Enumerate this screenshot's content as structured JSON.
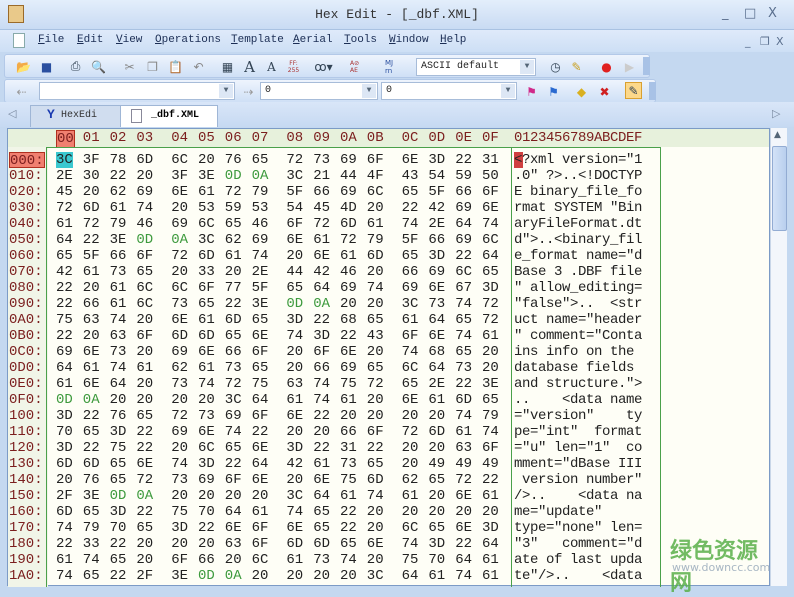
{
  "window": {
    "title": "Hex Edit - [_dbf.XML]",
    "minimize": "_",
    "maximize": "□",
    "close": "X"
  },
  "menu": [
    "File",
    "Edit",
    "View",
    "Operations",
    "Template",
    "Aerial",
    "Tools",
    "Window",
    "Help"
  ],
  "mdi": {
    "minimize": "_",
    "restore": "❐",
    "close": "X"
  },
  "toolbar": {
    "charset": "ASCII default",
    "font_large": "A",
    "font_small": "A",
    "ff_label": "FF: 255",
    "mj_label": "MJ rn",
    "ae_label": "A⊘ AE"
  },
  "toolbar2": {
    "search_value": "",
    "goto_value": "0",
    "offset_value": "0"
  },
  "tabs": [
    {
      "label": "HexEdi",
      "active": false
    },
    {
      "label": "_dbf.XML",
      "active": true
    }
  ],
  "header": {
    "columns": [
      "00",
      "01",
      "02",
      "03",
      "04",
      "05",
      "06",
      "07",
      "08",
      "09",
      "0A",
      "0B",
      "0C",
      "0D",
      "0E",
      "0F"
    ],
    "ascii": "0123456789ABCDEF"
  },
  "rows": [
    {
      "addr": "000:",
      "hex": "3C 3F 78 6D 6C 20 76 65 72 73 69 6F 6E 3D 22 31",
      "ascii": "<?xml version=\"1"
    },
    {
      "addr": "010:",
      "hex": "2E 30 22 20 3F 3E 0D 0A 3C 21 44 4F 43 54 59 50",
      "ascii": ".0\" ?>..<!DOCTYP"
    },
    {
      "addr": "020:",
      "hex": "45 20 62 69 6E 61 72 79 5F 66 69 6C 65 5F 66 6F",
      "ascii": "E binary_file_fo"
    },
    {
      "addr": "030:",
      "hex": "72 6D 61 74 20 53 59 53 54 45 4D 20 22 42 69 6E",
      "ascii": "rmat SYSTEM \"Bin"
    },
    {
      "addr": "040:",
      "hex": "61 72 79 46 69 6C 65 46 6F 72 6D 61 74 2E 64 74",
      "ascii": "aryFileFormat.dt"
    },
    {
      "addr": "050:",
      "hex": "64 22 3E 0D 0A 3C 62 69 6E 61 72 79 5F 66 69 6C",
      "ascii": "d\">..<binary_fil"
    },
    {
      "addr": "060:",
      "hex": "65 5F 66 6F 72 6D 61 74 20 6E 61 6D 65 3D 22 64",
      "ascii": "e_format name=\"d"
    },
    {
      "addr": "070:",
      "hex": "42 61 73 65 20 33 20 2E 44 42 46 20 66 69 6C 65",
      "ascii": "Base 3 .DBF file"
    },
    {
      "addr": "080:",
      "hex": "22 20 61 6C 6C 6F 77 5F 65 64 69 74 69 6E 67 3D",
      "ascii": "\" allow_editing="
    },
    {
      "addr": "090:",
      "hex": "22 66 61 6C 73 65 22 3E 0D 0A 20 20 3C 73 74 72",
      "ascii": "\"false\">..  <str"
    },
    {
      "addr": "0A0:",
      "hex": "75 63 74 20 6E 61 6D 65 3D 22 68 65 61 64 65 72",
      "ascii": "uct name=\"header"
    },
    {
      "addr": "0B0:",
      "hex": "22 20 63 6F 6D 6D 65 6E 74 3D 22 43 6F 6E 74 61",
      "ascii": "\" comment=\"Conta"
    },
    {
      "addr": "0C0:",
      "hex": "69 6E 73 20 69 6E 66 6F 20 6F 6E 20 74 68 65 20",
      "ascii": "ins info on the "
    },
    {
      "addr": "0D0:",
      "hex": "64 61 74 61 62 61 73 65 20 66 69 65 6C 64 73 20",
      "ascii": "database fields "
    },
    {
      "addr": "0E0:",
      "hex": "61 6E 64 20 73 74 72 75 63 74 75 72 65 2E 22 3E",
      "ascii": "and structure.\">"
    },
    {
      "addr": "0F0:",
      "hex": "0D 0A 20 20 20 20 3C 64 61 74 61 20 6E 61 6D 65",
      "ascii": "..    <data name"
    },
    {
      "addr": "100:",
      "hex": "3D 22 76 65 72 73 69 6F 6E 22 20 20 20 20 74 79",
      "ascii": "=\"version\"    ty"
    },
    {
      "addr": "110:",
      "hex": "70 65 3D 22 69 6E 74 22 20 20 66 6F 72 6D 61 74",
      "ascii": "pe=\"int\"  format"
    },
    {
      "addr": "120:",
      "hex": "3D 22 75 22 20 6C 65 6E 3D 22 31 22 20 20 63 6F",
      "ascii": "=\"u\" len=\"1\"  co"
    },
    {
      "addr": "130:",
      "hex": "6D 6D 65 6E 74 3D 22 64 42 61 73 65 20 49 49 49",
      "ascii": "mment=\"dBase III"
    },
    {
      "addr": "140:",
      "hex": "20 76 65 72 73 69 6F 6E 20 6E 75 6D 62 65 72 22",
      "ascii": " version number\""
    },
    {
      "addr": "150:",
      "hex": "2F 3E 0D 0A 20 20 20 20 3C 64 61 74 61 20 6E 61",
      "ascii": "/>..    <data na"
    },
    {
      "addr": "160:",
      "hex": "6D 65 3D 22 75 70 64 61 74 65 22 20 20 20 20 20",
      "ascii": "me=\"update\"     "
    },
    {
      "addr": "170:",
      "hex": "74 79 70 65 3D 22 6E 6F 6E 65 22 20 6C 65 6E 3D",
      "ascii": "type=\"none\" len="
    },
    {
      "addr": "180:",
      "hex": "22 33 22 20 20 20 63 6F 6D 6D 65 6E 74 3D 22 64",
      "ascii": "\"3\"   comment=\"d"
    },
    {
      "addr": "190:",
      "hex": "61 74 65 20 6F 66 20 6C 61 73 74 20 75 70 64 61",
      "ascii": "ate of last upda"
    },
    {
      "addr": "1A0:",
      "hex": "74 65 22 2F 3E 0D 0A 20 20 20 20 3C 64 61 74 61",
      "ascii": "te\"/>..    <data"
    }
  ],
  "watermark": {
    "text": "绿色资源网",
    "url": "www.downcc.com"
  },
  "colors": {
    "address": "#7b1e1e",
    "newline": "#3d9a3d",
    "cursor": "#3bc8cf",
    "header_highlight": "#f08070"
  }
}
